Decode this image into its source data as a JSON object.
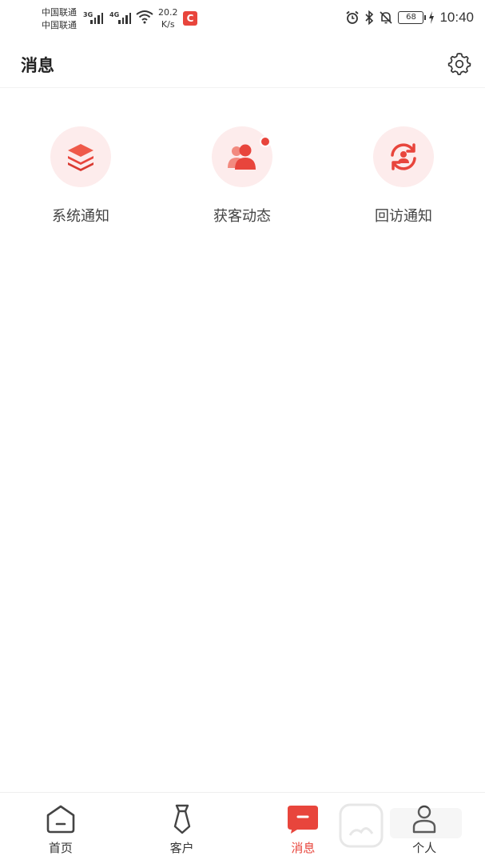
{
  "status_bar": {
    "carrier_1": "中国联通",
    "carrier_2": "中国联通",
    "net_1": "3G",
    "net_2": "4G",
    "speed_value": "20.2",
    "speed_unit": "K/s",
    "app_badge": "C",
    "battery": "68",
    "time": "10:40"
  },
  "header": {
    "title": "消息",
    "settings_icon": "gear-icon"
  },
  "categories": [
    {
      "label": "系统通知",
      "icon": "layers-icon",
      "has_dot": false
    },
    {
      "label": "获客动态",
      "icon": "users-icon",
      "has_dot": true
    },
    {
      "label": "回访通知",
      "icon": "refresh-user-icon",
      "has_dot": false
    }
  ],
  "bottom_nav": [
    {
      "label": "首页",
      "icon": "home-icon",
      "active": false
    },
    {
      "label": "客户",
      "icon": "tie-icon",
      "active": false
    },
    {
      "label": "消息",
      "icon": "message-icon",
      "active": true
    },
    {
      "label": "个人",
      "icon": "person-icon",
      "active": false
    }
  ],
  "colors": {
    "accent": "#e8453c",
    "icon_bg": "#fdecec"
  }
}
